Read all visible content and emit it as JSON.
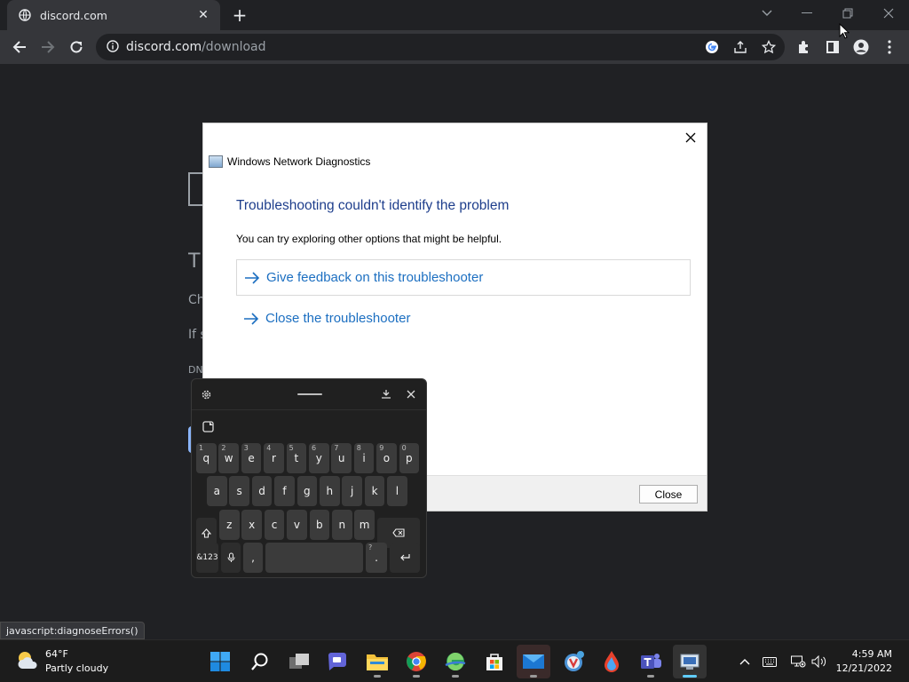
{
  "browser": {
    "tab_title": "discord.com",
    "url_host": "discord.com",
    "url_path": "/download",
    "status_text": "javascript:diagnoseErrors()"
  },
  "background_page": {
    "heading_fragment": "T",
    "line1_fragment": "Ch",
    "line2_fragment": "If s",
    "line3_fragment": "DN"
  },
  "dialog": {
    "app_title": "Windows Network Diagnostics",
    "heading": "Troubleshooting couldn't identify the problem",
    "subtitle": "You can try exploring other options that might be helpful.",
    "options": [
      {
        "label": "Give feedback on this troubleshooter"
      },
      {
        "label": "Close the troubleshooter"
      }
    ],
    "close_button": "Close",
    "accent_color": "#1c6fc1",
    "heading_color": "#1e3e8c"
  },
  "keyboard": {
    "row1": [
      {
        "k": "q",
        "n": "1"
      },
      {
        "k": "w",
        "n": "2"
      },
      {
        "k": "e",
        "n": "3"
      },
      {
        "k": "r",
        "n": "4"
      },
      {
        "k": "t",
        "n": "5"
      },
      {
        "k": "y",
        "n": "6"
      },
      {
        "k": "u",
        "n": "7"
      },
      {
        "k": "i",
        "n": "8"
      },
      {
        "k": "o",
        "n": "9"
      },
      {
        "k": "p",
        "n": "0"
      }
    ],
    "row2": [
      "a",
      "s",
      "d",
      "f",
      "g",
      "h",
      "j",
      "k",
      "l"
    ],
    "row3": [
      "z",
      "x",
      "c",
      "v",
      "b",
      "n",
      "m"
    ],
    "symbols_key": "&123",
    "comma_key": ",",
    "period_key": ".",
    "period_alt": "?"
  },
  "taskbar": {
    "weather_temp": "64°F",
    "weather_desc": "Partly cloudy",
    "time": "4:59 AM",
    "date": "12/21/2022"
  }
}
